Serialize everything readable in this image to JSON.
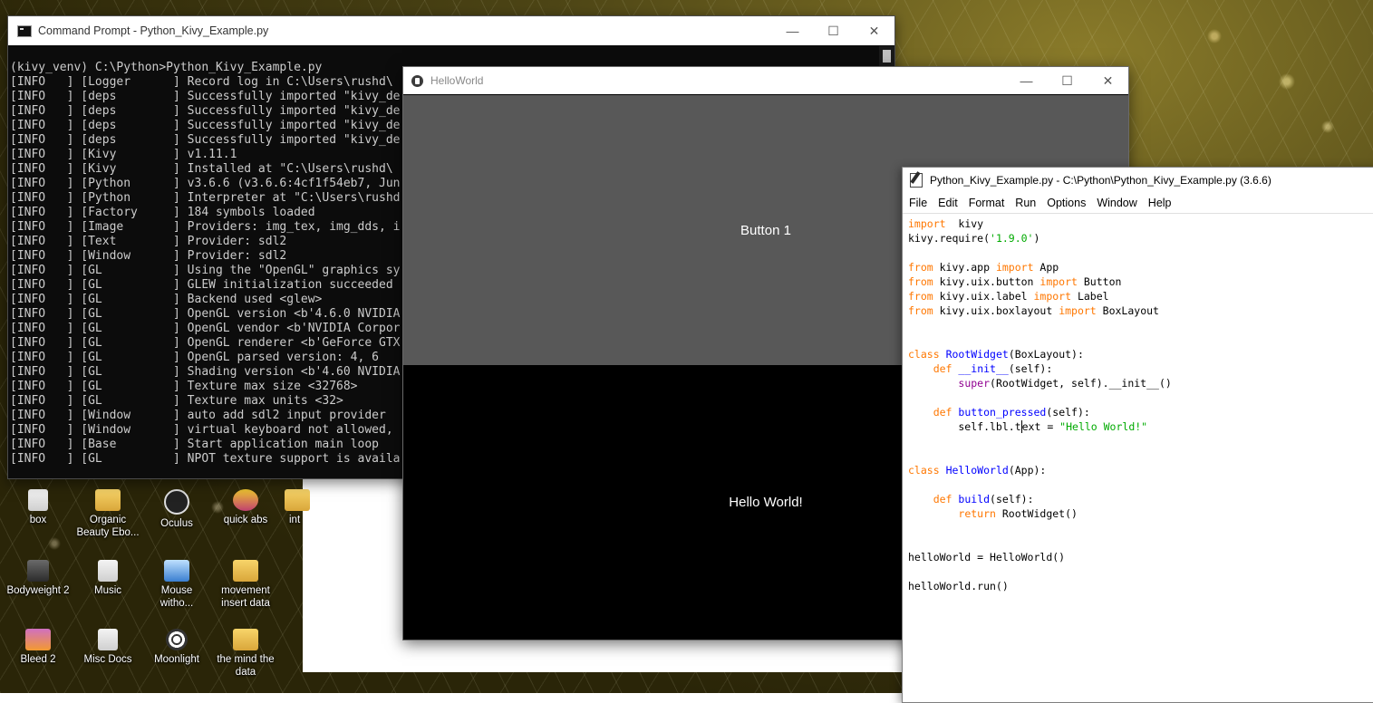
{
  "desktop": {
    "icons": [
      {
        "label": "box",
        "glyph": "file-icon"
      },
      {
        "label": "Organic Beauty Ebo...",
        "glyph": "folder-icon"
      },
      {
        "label": "Oculus",
        "glyph": "oculus-icon"
      },
      {
        "label": "quick abs",
        "glyph": "music-icon"
      },
      {
        "label": "int",
        "glyph": "folder-icon"
      },
      {
        "label": "Bodyweight 2",
        "glyph": "photo-icon"
      },
      {
        "label": "Music",
        "glyph": "file-icon"
      },
      {
        "label": "Mouse witho...",
        "glyph": "mouse-icon"
      },
      {
        "label": "movement insert data",
        "glyph": "folder-icon"
      },
      {
        "label": "Bleed 2",
        "glyph": "game-icon"
      },
      {
        "label": "Misc Docs",
        "glyph": "file-icon"
      },
      {
        "label": "Moonlight",
        "glyph": "wheel-icon"
      },
      {
        "label": "the mind the data",
        "glyph": "folder-icon"
      }
    ]
  },
  "cmd": {
    "title": "Command Prompt - Python_Kivy_Example.py",
    "lines": [
      "(kivy_venv) C:\\Python>Python_Kivy_Example.py",
      "[INFO   ] [Logger      ] Record log in C:\\Users\\rushd\\",
      "[INFO   ] [deps        ] Successfully imported \"kivy_de",
      "[INFO   ] [deps        ] Successfully imported \"kivy_de",
      "[INFO   ] [deps        ] Successfully imported \"kivy_de",
      "[INFO   ] [deps        ] Successfully imported \"kivy_de",
      "[INFO   ] [Kivy        ] v1.11.1",
      "[INFO   ] [Kivy        ] Installed at \"C:\\Users\\rushd\\",
      "[INFO   ] [Python      ] v3.6.6 (v3.6.6:4cf1f54eb7, Jun",
      "[INFO   ] [Python      ] Interpreter at \"C:\\Users\\rushd",
      "[INFO   ] [Factory     ] 184 symbols loaded",
      "[INFO   ] [Image       ] Providers: img_tex, img_dds, i",
      "[INFO   ] [Text        ] Provider: sdl2",
      "[INFO   ] [Window      ] Provider: sdl2",
      "[INFO   ] [GL          ] Using the \"OpenGL\" graphics sy",
      "[INFO   ] [GL          ] GLEW initialization succeeded",
      "[INFO   ] [GL          ] Backend used <glew>",
      "[INFO   ] [GL          ] OpenGL version <b'4.6.0 NVIDIA",
      "[INFO   ] [GL          ] OpenGL vendor <b'NVIDIA Corpor",
      "[INFO   ] [GL          ] OpenGL renderer <b'GeForce GTX",
      "[INFO   ] [GL          ] OpenGL parsed version: 4, 6",
      "[INFO   ] [GL          ] Shading version <b'4.60 NVIDIA",
      "[INFO   ] [GL          ] Texture max size <32768>",
      "[INFO   ] [GL          ] Texture max units <32>",
      "[INFO   ] [Window      ] auto add sdl2 input provider",
      "[INFO   ] [Window      ] virtual keyboard not allowed,",
      "[INFO   ] [Base        ] Start application main loop",
      "[INFO   ] [GL          ] NPOT texture support is availa"
    ],
    "minimize": "—",
    "maximize": "☐",
    "close": "✕"
  },
  "kivy": {
    "title": "HelloWorld",
    "button_label": "Button 1",
    "label_text": "Hello World!",
    "minimize": "—",
    "maximize": "☐",
    "close": "✕"
  },
  "idle": {
    "title": "Python_Kivy_Example.py - C:\\Python\\Python_Kivy_Example.py (3.6.6)",
    "menu": [
      "File",
      "Edit",
      "Format",
      "Run",
      "Options",
      "Window",
      "Help"
    ],
    "code_lines": [
      [
        [
          "kw",
          "import"
        ],
        [
          "",
          "  kivy"
        ]
      ],
      [
        [
          "",
          "kivy.require("
        ],
        [
          "st",
          "'1.9.0'"
        ],
        [
          "",
          ")"
        ]
      ],
      [],
      [
        [
          "kw",
          "from"
        ],
        [
          "",
          " kivy.app "
        ],
        [
          "kw",
          "import"
        ],
        [
          "",
          " App"
        ]
      ],
      [
        [
          "kw",
          "from"
        ],
        [
          "",
          " kivy.uix.button "
        ],
        [
          "kw",
          "import"
        ],
        [
          "",
          " Button"
        ]
      ],
      [
        [
          "kw",
          "from"
        ],
        [
          "",
          " kivy.uix.label "
        ],
        [
          "kw",
          "import"
        ],
        [
          "",
          " Label"
        ]
      ],
      [
        [
          "kw",
          "from"
        ],
        [
          "",
          " kivy.uix.boxlayout "
        ],
        [
          "kw",
          "import"
        ],
        [
          "",
          " BoxLayout"
        ]
      ],
      [],
      [],
      [
        [
          "kw",
          "class"
        ],
        [
          "",
          " "
        ],
        [
          "df",
          "RootWidget"
        ],
        [
          "",
          "(BoxLayout):"
        ]
      ],
      [
        [
          "",
          "    "
        ],
        [
          "kw",
          "def"
        ],
        [
          "",
          " "
        ],
        [
          "df",
          "__init__"
        ],
        [
          "",
          "(self):"
        ]
      ],
      [
        [
          "",
          "        "
        ],
        [
          "bi",
          "super"
        ],
        [
          "",
          "(RootWidget, self).__init__()"
        ]
      ],
      [],
      [
        [
          "",
          "    "
        ],
        [
          "kw",
          "def"
        ],
        [
          "",
          " "
        ],
        [
          "df",
          "button_pressed"
        ],
        [
          "",
          "(self):"
        ]
      ],
      [
        [
          "",
          "        self.lbl.t"
        ],
        [
          "caret",
          ""
        ],
        [
          "",
          "ext = "
        ],
        [
          "st",
          "\"Hello World!\""
        ]
      ],
      [],
      [],
      [
        [
          "kw",
          "class"
        ],
        [
          "",
          " "
        ],
        [
          "df",
          "HelloWorld"
        ],
        [
          "",
          "(App):"
        ]
      ],
      [],
      [
        [
          "",
          "    "
        ],
        [
          "kw",
          "def"
        ],
        [
          "",
          " "
        ],
        [
          "df",
          "build"
        ],
        [
          "",
          "(self):"
        ]
      ],
      [
        [
          "",
          "        "
        ],
        [
          "kw",
          "return"
        ],
        [
          "",
          " RootWidget()"
        ]
      ],
      [],
      [],
      [
        [
          "",
          "helloWorld = HelloWorld()"
        ]
      ],
      [],
      [
        [
          "",
          "helloWorld.run()"
        ]
      ]
    ]
  }
}
